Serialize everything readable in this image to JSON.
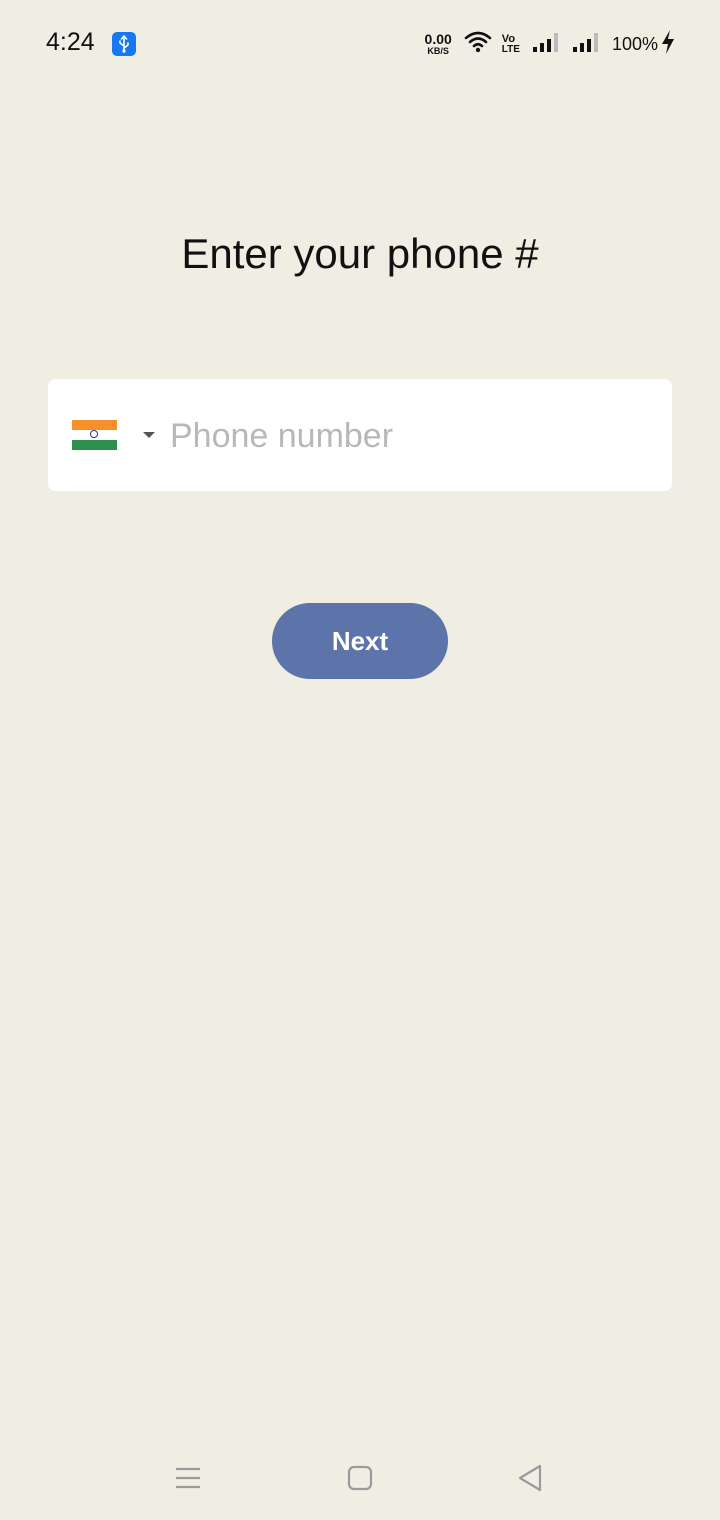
{
  "status_bar": {
    "time": "4:24",
    "net_speed_value": "0.00",
    "net_speed_unit": "KB/S",
    "volte_top": "Vo",
    "volte_bottom": "LTE",
    "battery": "100%"
  },
  "title": "Enter your phone #",
  "phone_field": {
    "country_flag": "india-flag-icon",
    "placeholder": "Phone number",
    "value": ""
  },
  "next_button": {
    "label": "Next"
  },
  "colors": {
    "background": "#f0eee3",
    "button": "#5c74a9",
    "field": "#ffffff",
    "placeholder": "#b8b8b8"
  },
  "icons": {
    "usb": "usb-icon",
    "wifi": "wifi-icon",
    "signal": "signal-icon",
    "charging": "charging-bolt-icon",
    "nav_menu": "menu-icon",
    "nav_home": "home-square-icon",
    "nav_back": "back-triangle-icon"
  }
}
